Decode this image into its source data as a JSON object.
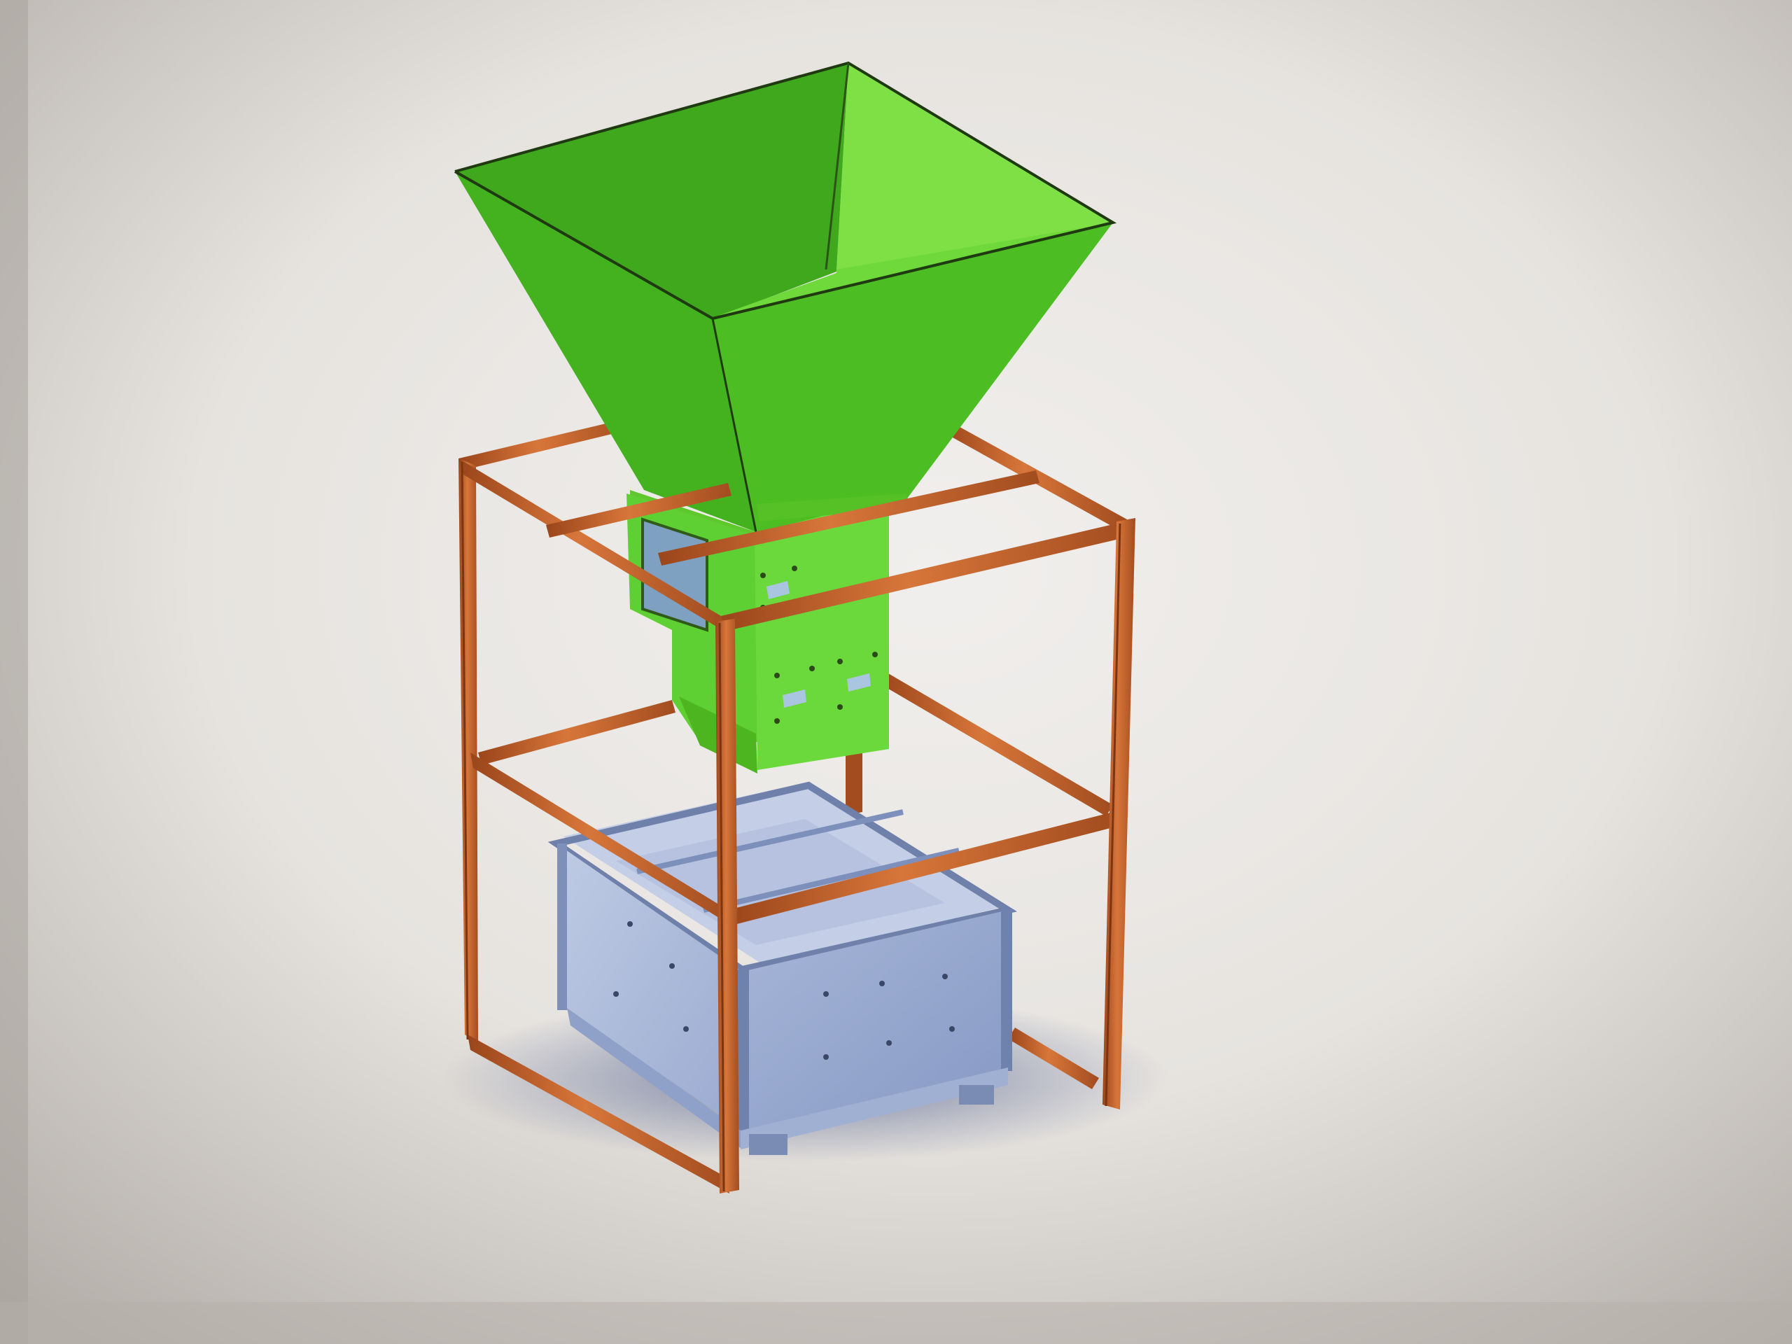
{
  "scene": {
    "subject": "hopper-frame-crate-assembly",
    "colors": {
      "background_light": "#e9e7e4",
      "background_dark": "#b9b6b1",
      "hopper_light": "#6fd93a",
      "hopper_mid": "#4fbd22",
      "hopper_dark": "#38991a",
      "frame": "#c7642a",
      "frame_dark": "#8e3f16",
      "crate_light": "#b2c0dd",
      "crate_mid": "#94a6cc",
      "crate_dark": "#7385ae",
      "crate_line": "#3b4766",
      "shaft": "#a9c5df",
      "shadow": "#5b6a96"
    },
    "icons": [
      "hopper-icon",
      "frame-icon",
      "crate-icon",
      "shaft-icon"
    ]
  }
}
